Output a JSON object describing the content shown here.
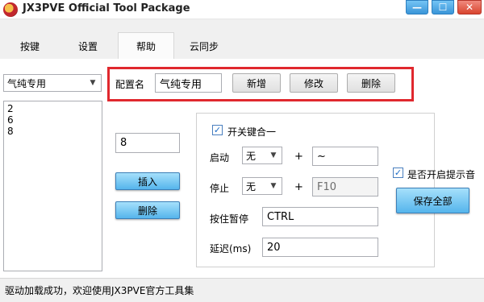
{
  "window": {
    "title": "JX3PVE Official Tool Package",
    "min_icon": "—",
    "max_icon": "☐",
    "close_icon": "✕"
  },
  "tabs": [
    "按键",
    "设置",
    "帮助",
    "云同步"
  ],
  "active_tab": "帮助",
  "profile": {
    "selected": "气纯专用",
    "config_label": "配置名",
    "config_value": "气纯专用",
    "add_label": "新增",
    "modify_label": "修改",
    "delete_label": "删除"
  },
  "key_list": [
    "2",
    "6",
    "8"
  ],
  "key_input": "8",
  "insert_label": "插入",
  "remove_label": "删除",
  "toggle": {
    "checkbox_label": "开关键合一",
    "checked": true,
    "start_label": "启动",
    "start_modifier": "无",
    "start_key": "~",
    "stop_label": "停止",
    "stop_modifier": "无",
    "stop_key": "F10",
    "hold_label": "按住暂停",
    "hold_key": "CTRL",
    "delay_label": "延迟(ms)",
    "delay_value": "20",
    "plus": "+"
  },
  "sound": {
    "label": "是否开启提示音",
    "checked": true
  },
  "save_all_label": "保存全部",
  "status": "驱动加载成功，欢迎使用JX3PVE官方工具集",
  "colors": {
    "highlight_box": "#e0282e",
    "blue_button": "#55b5ec"
  }
}
